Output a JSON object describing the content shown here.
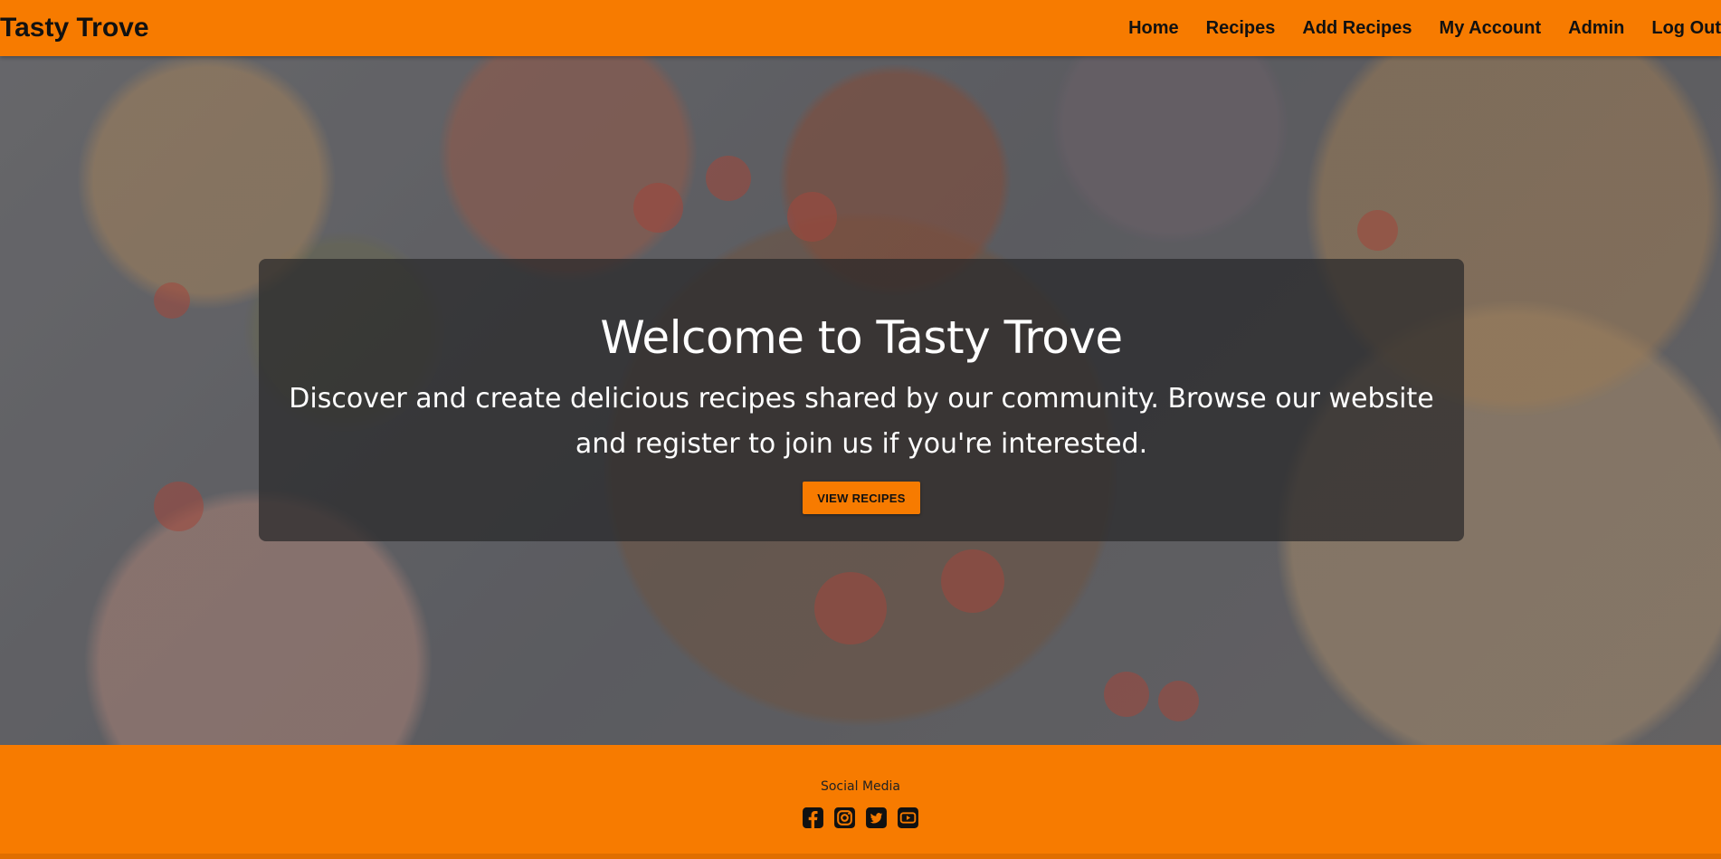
{
  "brand": "Tasty Trove",
  "nav": {
    "items": [
      {
        "label": "Home"
      },
      {
        "label": "Recipes"
      },
      {
        "label": "Add Recipes"
      },
      {
        "label": "My Account"
      },
      {
        "label": "Admin"
      },
      {
        "label": "Log Out"
      }
    ]
  },
  "hero": {
    "title": "Welcome to Tasty Trove",
    "text": "Discover and create delicious recipes shared by our community. Browse our website and register to join us if you're interested.",
    "button_label": "VIEW RECIPES"
  },
  "footer": {
    "title": "Social Media",
    "icons": [
      "facebook-icon",
      "instagram-icon",
      "twitter-icon",
      "youtube-icon"
    ]
  },
  "colors": {
    "accent": "#f77b00",
    "overlay": "rgba(40,40,42,0.72)"
  }
}
